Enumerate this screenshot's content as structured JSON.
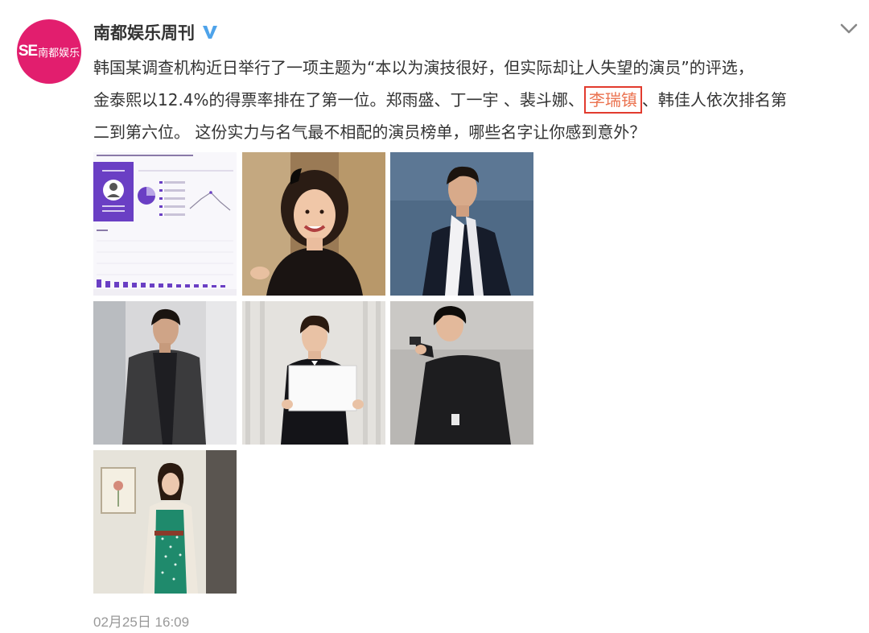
{
  "post": {
    "author": "南都娱乐周刊",
    "avatar_text": {
      "se": "SE",
      "cn": "南都娱乐"
    },
    "text_lines": [
      "韩国某调查机构近日举行了一项主题为“本以为演技很好，但实际却让人失望的演员”的评选，",
      "金泰熙以12.4%的得票率排在了第一位。郑雨盛、丁一宇 、裴斗娜、",
      "、韩佳人依次排名第",
      "二到第六位。 这份实力与名气最不相配的演员榜单，哪些名字让你感到意外？"
    ],
    "highlight": "李瑞镇",
    "timestamp": "02月25日 16:09"
  },
  "icons": {
    "verified": "verified-badge-icon",
    "chevron": "chevron-down-icon"
  },
  "colors": {
    "brand": "#e21e6e",
    "highlight_text": "#eb7350",
    "highlight_box": "#e23b2e",
    "verified": "#4ea3ea",
    "chart_purple": "#6a3fc4"
  }
}
